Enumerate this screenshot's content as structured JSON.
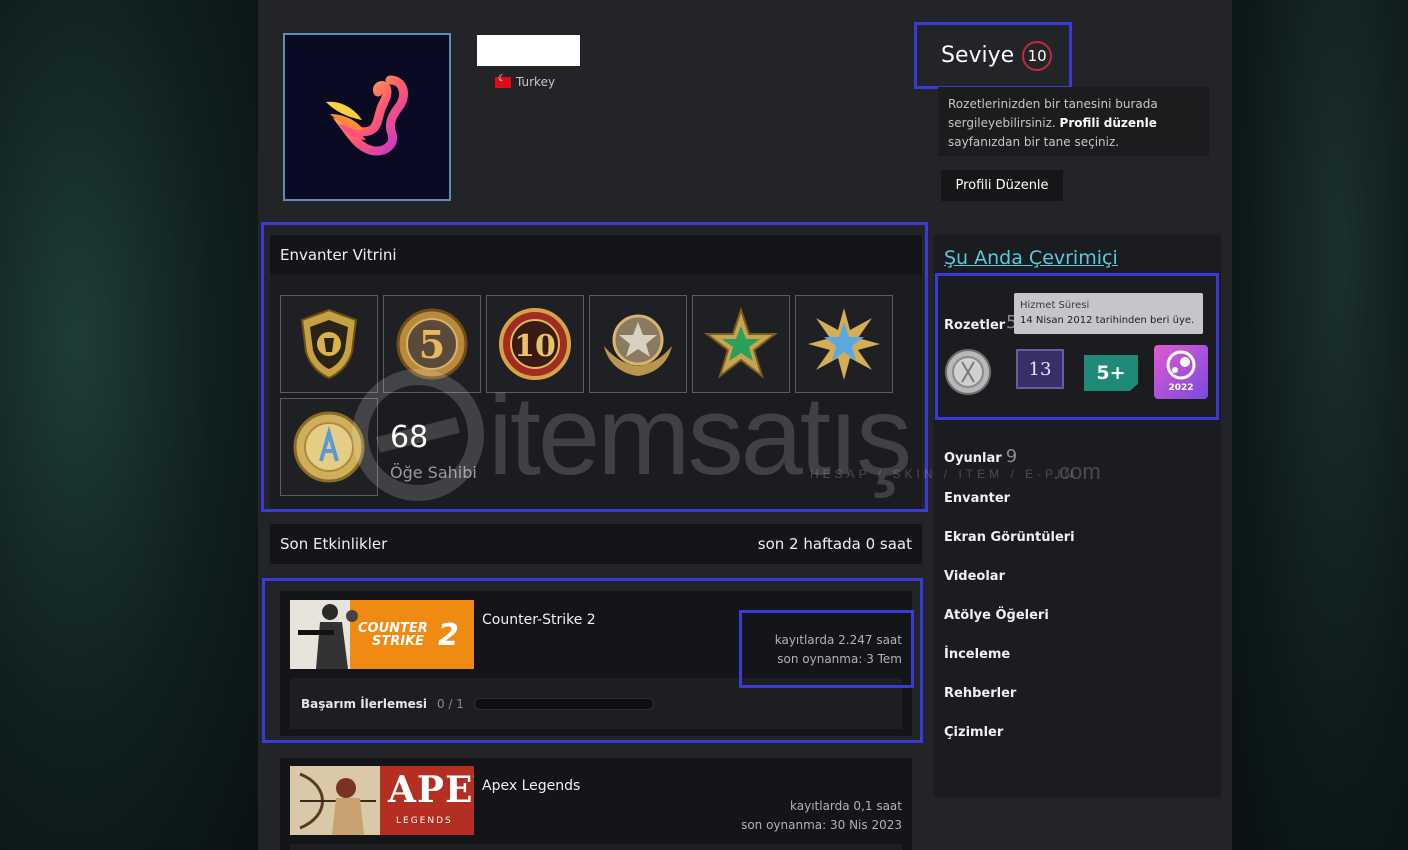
{
  "profile": {
    "country": "Turkey"
  },
  "level": {
    "label": "Seviye",
    "value": "10"
  },
  "badge_hint": {
    "text_1": "Rozetlerinizden bir tanesini burada sergileyebilirsiniz.",
    "link": "Profili düzenle",
    "text_2": "sayfanızdan bir tane seçiniz."
  },
  "edit_profile_button": "Profili Düzenle",
  "inventory": {
    "title": "Envanter Vitrini",
    "items": [
      {
        "icon": "cs-go-pin-icon"
      },
      {
        "icon": "five-year-veteran-coin-icon"
      },
      {
        "icon": "ten-year-veteran-coin-icon"
      },
      {
        "icon": "global-elite-coin-icon"
      },
      {
        "icon": "green-star-medal-icon"
      },
      {
        "icon": "blue-star-medal-icon"
      },
      {
        "icon": "gold-service-coin-icon"
      }
    ],
    "count": "68",
    "count_label": "Öğe Sahibi"
  },
  "activity": {
    "title": "Son Etkinlikler",
    "summary": "son 2 haftada 0 saat",
    "games": [
      {
        "name": "Counter-Strike 2",
        "hours": "kayıtlarda 2.247 saat",
        "last_played": "son oynanma: 3 Tem",
        "banner_text_1": "COUNTER",
        "banner_text_2": "STRIKE",
        "achievement_label": "Başarım İlerlemesi",
        "achievement_value": "0 / 1",
        "achievement_progress": 0
      },
      {
        "name": "Apex Legends",
        "hours": "kayıtlarda 0,1 saat",
        "last_played": "son oynanma: 30 Nis 2023",
        "banner_text_1": "APEX",
        "banner_text_2": "LEGENDS"
      }
    ]
  },
  "sidebar": {
    "online_status": "Şu Anda Çevrimiçi",
    "badges_label": "Rozetler",
    "badges_count": "5",
    "tooltip_title": "Hizmet Süresi",
    "tooltip_text": "14 Nisan 2012 tarihinden beri üye.",
    "badge_items": [
      {
        "icon": "silver-coin-badge-icon"
      },
      {
        "icon": "years-of-service-badge-icon",
        "value": "13"
      },
      {
        "icon": "games-owned-badge-icon",
        "value": "5+"
      },
      {
        "icon": "steam-2022-badge-icon",
        "value": "2022"
      }
    ],
    "games_label": "Oyunlar",
    "games_count": "9",
    "links": [
      "Envanter",
      "Ekran Görüntüleri",
      "Videolar",
      "Atölye Öğeleri",
      "İnceleme",
      "Rehberler",
      "Çizimler"
    ]
  },
  "watermark": {
    "text": "itemsatış",
    "sub": "HESAP / SKIN / ITEM / E-PIN",
    "com": ".com"
  },
  "colors": {
    "accent_outline": "#3a3ad6",
    "online": "#57cbde",
    "level_ring": "#c02942"
  }
}
